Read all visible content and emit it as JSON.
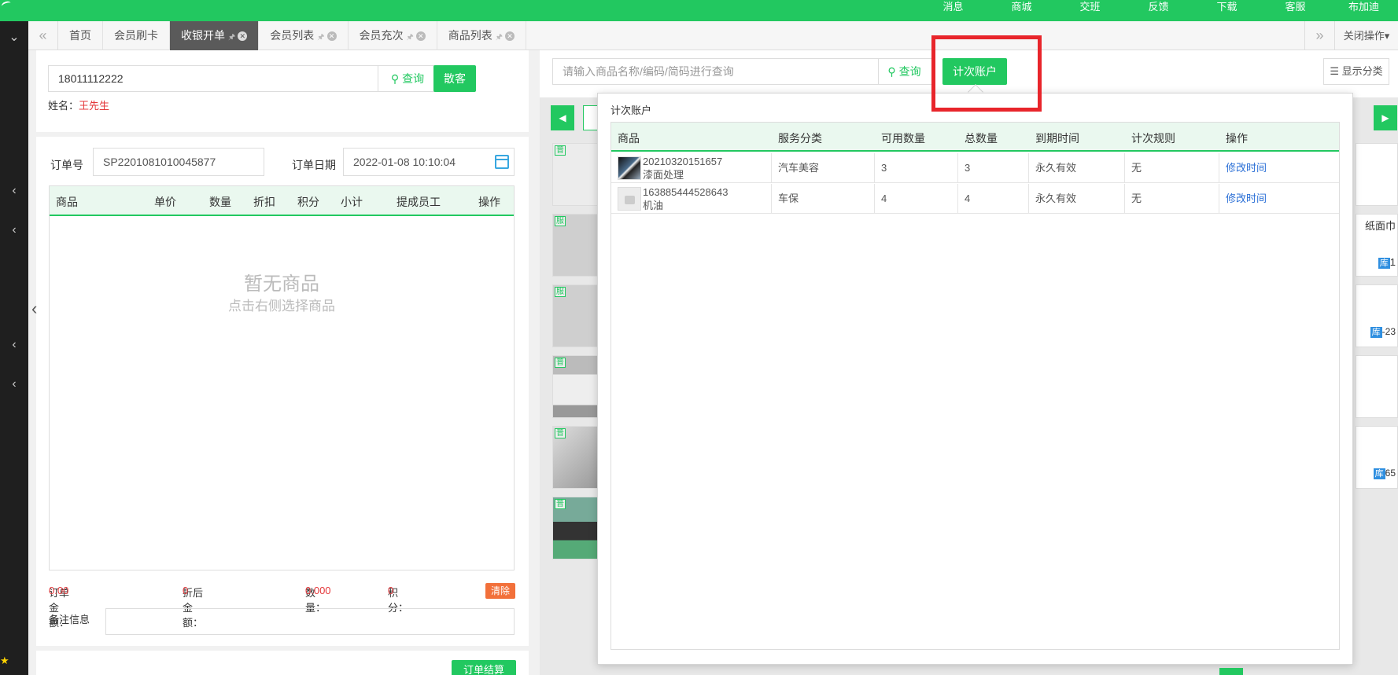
{
  "topnav": [
    "消息",
    "商城",
    "交班",
    "反馈",
    "下载",
    "客服",
    "布加迪"
  ],
  "tabs": [
    {
      "label": "首页",
      "pin": false,
      "close": false,
      "active": false
    },
    {
      "label": "会员刷卡",
      "pin": false,
      "close": false,
      "active": false
    },
    {
      "label": "收银开单",
      "pin": true,
      "close": true,
      "active": true
    },
    {
      "label": "会员列表",
      "pin": true,
      "close": true,
      "active": false
    },
    {
      "label": "会员充次",
      "pin": true,
      "close": true,
      "active": false
    },
    {
      "label": "商品列表",
      "pin": true,
      "close": true,
      "active": false
    }
  ],
  "tabbar": {
    "close_ops": "关闭操作▾"
  },
  "member": {
    "phone": "18011112222",
    "query_label": "查询",
    "guest_label": "散客",
    "name_label": "姓名：",
    "name_value": "王先生"
  },
  "order": {
    "no_label": "订单号",
    "no_value": "SP2201081010045877",
    "date_label": "订单日期",
    "date_value": "2022-01-08 10:10:04",
    "columns": [
      "商品",
      "单价",
      "数量",
      "折扣",
      "积分",
      "小计",
      "提成员工",
      "操作"
    ],
    "empty_title": "暂无商品",
    "empty_sub": "点击右侧选择商品",
    "amount_label": "订单金额：",
    "amount_value": "0.00",
    "discounted_label": "折后金额：",
    "discounted_value": "0",
    "qty_label": "数量：",
    "qty_value": "0.000",
    "points_label": "积分：",
    "points_value": "0",
    "clear_label": "清除",
    "remark_label": "备注信息",
    "settle_label": "订单结算"
  },
  "goods_panel": {
    "search_placeholder": "请输入商品名称/编码/简码进行查询",
    "query_label": "查询",
    "count_account_label": "计次账户",
    "show_category_label": "显示分类",
    "thumb_tags": [
      "普",
      "服",
      "服",
      "普",
      "普",
      "普"
    ],
    "right_fragments": [
      {
        "text": "纸面巾",
        "stock": "库",
        "qty": "1"
      },
      {
        "text": "",
        "stock": "库",
        "qty": "-23"
      },
      {
        "text": "",
        "stock": "",
        "qty": ""
      },
      {
        "text": "",
        "stock": "库",
        "qty": "65"
      }
    ]
  },
  "popup": {
    "title": "计次账户",
    "columns": [
      "商品",
      "服务分类",
      "可用数量",
      "总数量",
      "到期时间",
      "计次规则",
      "操作"
    ],
    "rows": [
      {
        "code": "20210320151657",
        "name": "漆面处理",
        "category": "汽车美容",
        "available": "3",
        "total": "3",
        "expiry": "永久有效",
        "rule": "无",
        "action": "修改时间"
      },
      {
        "code": "163885444528643",
        "name": "机油",
        "category": "车保",
        "available": "4",
        "total": "4",
        "expiry": "永久有效",
        "rule": "无",
        "action": "修改时间"
      }
    ]
  },
  "colors": {
    "brand": "#22c860",
    "danger": "#e4393c",
    "link": "#2a6fd6",
    "highlight": "#e8252b"
  }
}
